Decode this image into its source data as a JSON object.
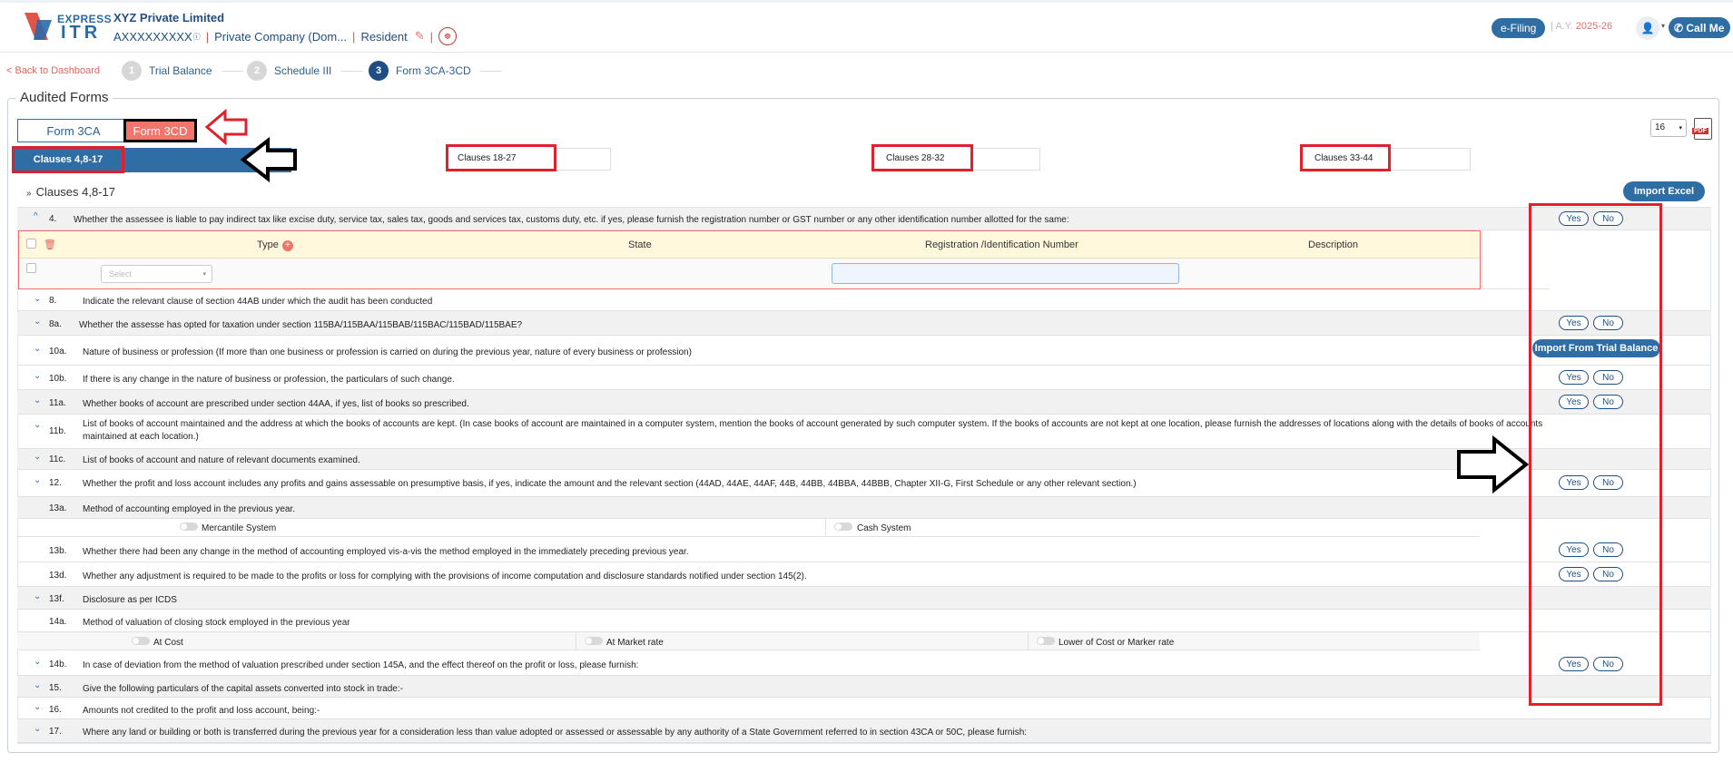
{
  "header": {
    "logo_express": "EXPRESS",
    "logo_itr": "ITR",
    "company_name": "XYZ Private Limited",
    "pan": "AXXXXXXXXX",
    "company_type": "Private Company (Dom...",
    "residency": "Resident",
    "efiling_label": "e-Filing",
    "ay_label": "A.Y.",
    "ay_value": "2025-26",
    "callme_label": "Call Me"
  },
  "stepper": {
    "back_label": "< Back to Dashboard",
    "steps": [
      {
        "num": "1",
        "label": "Trial Balance"
      },
      {
        "num": "2",
        "label": "Schedule III"
      },
      {
        "num": "3",
        "label": "Form 3CA-3CD"
      }
    ]
  },
  "audited": {
    "legend": "Audited Forms",
    "form_tabs": [
      "Form 3CA",
      "Form 3CD"
    ],
    "page_select": "16",
    "pdf_label": "PDF",
    "clause_tabs": [
      "Clauses 4,8-17",
      "Clauses 18-27",
      "Clauses 28-32",
      "Clauses 33-44"
    ],
    "section_title": "Clauses 4,8-17",
    "import_excel": "Import Excel",
    "import_trial_balance": "Import From Trial Balance",
    "yes": "Yes",
    "no": "No"
  },
  "gst_table": {
    "columns": [
      "Type",
      "State",
      "Registration /Identification Number",
      "Description"
    ],
    "select_placeholder": "Select"
  },
  "clauses": [
    {
      "num": "4.",
      "text": "Whether the assessee is liable to pay indirect tax like excise duty, service tax, sales tax, goods and services tax, customs duty, etc. if yes, please furnish the registration number or GST number or any other identification number allotted for the same:"
    },
    {
      "num": "8.",
      "text": "Indicate the relevant clause of section 44AB under which the audit has been conducted"
    },
    {
      "num": "8a.",
      "text": "Whether the assesse has opted for taxation under section 115BA/115BAA/115BAB/115BAC/115BAD/115BAE?"
    },
    {
      "num": "10a.",
      "text": "Nature of business or profession (If more than one business or profession is carried on during the previous year, nature of every business or profession)"
    },
    {
      "num": "10b.",
      "text": "If there is any change in the nature of business or profession, the particulars of such change."
    },
    {
      "num": "11a.",
      "text": "Whether books of account are prescribed under section 44AA, if yes, list of books so prescribed."
    },
    {
      "num": "11b.",
      "text": "List of books of account maintained and the address at which the books of accounts are kept. (In case books of account are maintained in a computer system, mention the books of account generated by such computer system. If the books of accounts are not kept at one location, please furnish the addresses of locations along with the details of books of accounts maintained at each location.)"
    },
    {
      "num": "11c.",
      "text": "List of books of account and nature of relevant documents examined."
    },
    {
      "num": "12.",
      "text": "Whether the profit and loss account includes any profits and gains assessable on presumptive basis, if yes, indicate the amount and the relevant section (44AD, 44AE, 44AF, 44B, 44BB, 44BBA, 44BBB, Chapter XII-G, First Schedule or any other relevant section.)"
    },
    {
      "num": "13a.",
      "text": "Method of accounting employed in the previous year."
    },
    {
      "num": "13b.",
      "text": "Whether there had been any change in the method of accounting employed vis-a-vis the method employed in the immediately preceding previous year."
    },
    {
      "num": "13d.",
      "text": "Whether any adjustment is required to be made to the profits or loss for complying with the provisions of income computation and disclosure standards notified under section 145(2)."
    },
    {
      "num": "13f.",
      "text": "Disclosure as per ICDS"
    },
    {
      "num": "14a.",
      "text": "Method of valuation of closing stock employed in the previous year"
    },
    {
      "num": "14b.",
      "text": "In case of deviation from the method of valuation prescribed under section 145A, and the effect thereof on the profit or loss, please furnish:"
    },
    {
      "num": "15.",
      "text": "Give the following particulars of the capital assets converted into stock in trade:-"
    },
    {
      "num": "16.",
      "text": "Amounts not credited to the profit and loss account, being:-"
    },
    {
      "num": "17.",
      "text": "Where any land or building or both is transferred during the previous year for a consideration less than value adopted or assessed or assessable by any authority of a State Government referred to in section 43CA or 50C, please furnish:"
    }
  ],
  "options_13a": [
    "Mercantile System",
    "Cash System"
  ],
  "options_14a": [
    "At Cost",
    "At Market rate",
    "Lower of Cost or Marker rate"
  ],
  "colors": {
    "primary": "#2f6ea5",
    "accent": "#f0756b",
    "annotation": "#e0202a"
  }
}
